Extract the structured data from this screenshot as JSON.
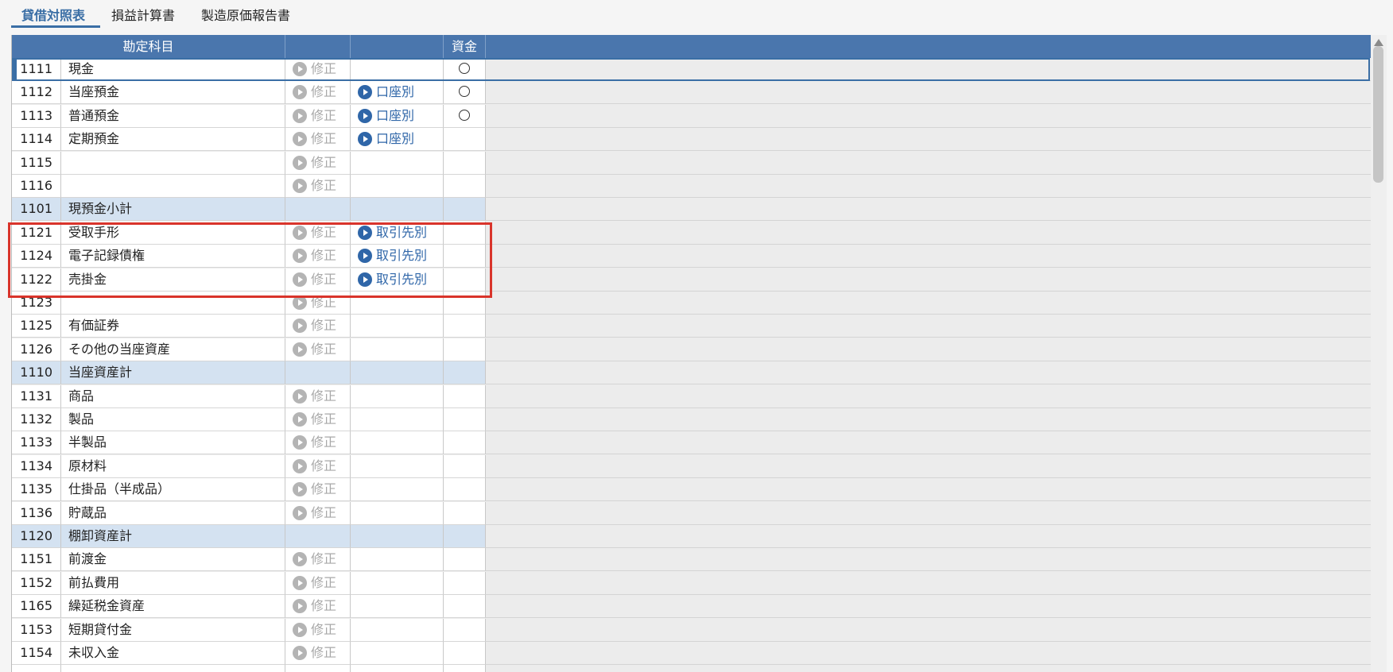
{
  "tabs": [
    "貸借対照表",
    "損益計算書",
    "製造原価報告書"
  ],
  "columns": {
    "account": "勘定科目",
    "modify": "",
    "detail": "",
    "funds": "資金"
  },
  "buttons": {
    "modify": "修正",
    "by_account": "口座別",
    "by_partner": "取引先別"
  },
  "colors": {
    "accent": "#3a6ea5",
    "header": "#4a76ad",
    "subtotal_row": "#d4e2f1",
    "highlight": "#d9342b"
  },
  "rows": [
    {
      "code": "1111",
      "name": "現金",
      "modify": true,
      "detail": null,
      "funds": true
    },
    {
      "code": "1112",
      "name": "当座預金",
      "modify": true,
      "detail": "by_account",
      "funds": true
    },
    {
      "code": "1113",
      "name": "普通預金",
      "modify": true,
      "detail": "by_account",
      "funds": true
    },
    {
      "code": "1114",
      "name": "定期預金",
      "modify": true,
      "detail": "by_account",
      "funds": false
    },
    {
      "code": "1115",
      "name": "",
      "modify": true,
      "detail": null,
      "funds": false
    },
    {
      "code": "1116",
      "name": "",
      "modify": true,
      "detail": null,
      "funds": false
    },
    {
      "code": "1101",
      "name": "現預金小計",
      "subtotal": true
    },
    {
      "code": "1121",
      "name": "受取手形",
      "modify": true,
      "detail": "by_partner",
      "funds": false
    },
    {
      "code": "1124",
      "name": "電子記録債権",
      "modify": true,
      "detail": "by_partner",
      "funds": false
    },
    {
      "code": "1122",
      "name": "売掛金",
      "modify": true,
      "detail": "by_partner",
      "funds": false
    },
    {
      "code": "1123",
      "name": "",
      "modify": true,
      "detail": null,
      "funds": false
    },
    {
      "code": "1125",
      "name": "有価証券",
      "modify": true,
      "detail": null,
      "funds": false
    },
    {
      "code": "1126",
      "name": "その他の当座資産",
      "modify": true,
      "detail": null,
      "funds": false
    },
    {
      "code": "1110",
      "name": "当座資産計",
      "subtotal": true
    },
    {
      "code": "1131",
      "name": "商品",
      "modify": true,
      "detail": null,
      "funds": false
    },
    {
      "code": "1132",
      "name": "製品",
      "modify": true,
      "detail": null,
      "funds": false
    },
    {
      "code": "1133",
      "name": "半製品",
      "modify": true,
      "detail": null,
      "funds": false
    },
    {
      "code": "1134",
      "name": "原材料",
      "modify": true,
      "detail": null,
      "funds": false
    },
    {
      "code": "1135",
      "name": "仕掛品（半成品）",
      "modify": true,
      "detail": null,
      "funds": false
    },
    {
      "code": "1136",
      "name": "貯蔵品",
      "modify": true,
      "detail": null,
      "funds": false
    },
    {
      "code": "1120",
      "name": "棚卸資産計",
      "subtotal": true
    },
    {
      "code": "1151",
      "name": "前渡金",
      "modify": true,
      "detail": null,
      "funds": false
    },
    {
      "code": "1152",
      "name": "前払費用",
      "modify": true,
      "detail": null,
      "funds": false
    },
    {
      "code": "1165",
      "name": "繰延税金資産",
      "modify": true,
      "detail": null,
      "funds": false
    },
    {
      "code": "1153",
      "name": "短期貸付金",
      "modify": true,
      "detail": null,
      "funds": false
    },
    {
      "code": "1154",
      "name": "未収入金",
      "modify": true,
      "detail": null,
      "funds": false
    },
    {
      "code": "",
      "name": "",
      "modify": false,
      "detail": null,
      "funds": false
    }
  ]
}
